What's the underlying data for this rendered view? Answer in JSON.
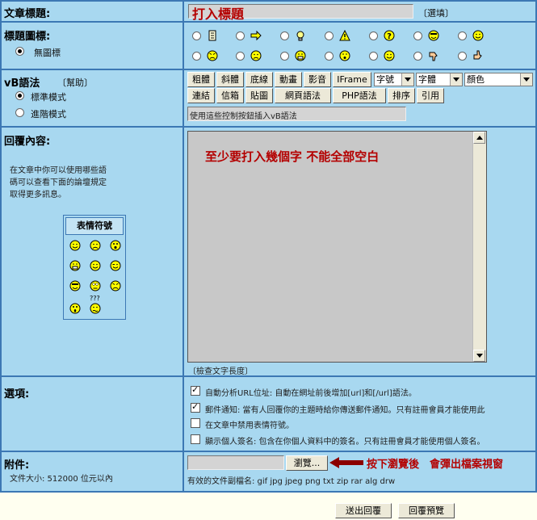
{
  "subject": {
    "label": "文章標題:",
    "value": "打入標題",
    "optional": "〔選填〕"
  },
  "title_icon": {
    "label": "標題圖標:",
    "no_icon_label": "無圖標"
  },
  "vbcode": {
    "label": "vB語法",
    "help": "〔幫助〕",
    "mode_standard": "標準模式",
    "mode_advanced": "進階模式",
    "buttons_row1": [
      "粗體",
      "斜體",
      "底線",
      "動畫",
      "影音",
      "IFrame"
    ],
    "buttons_row2": [
      "連結",
      "信箱",
      "貼圖",
      "網頁語法",
      "PHP語法",
      "排序",
      "引用"
    ],
    "size_select": "字號",
    "font_select": "字體",
    "color_select": "顏色",
    "status_text": "使用這些控制按鈕插入vB語法"
  },
  "reply": {
    "label": "回覆內容:",
    "help_text": [
      "在文章中你可以使用哪些語",
      "碼可以查看下面的論壇規定",
      "取得更多訊息。"
    ],
    "smilies_title": "表情符號",
    "smilies_extra": "???",
    "message_text": "至少要打入幾個字 不能全部空白",
    "check_length": "〔檢查文字長度〕"
  },
  "options": {
    "label": "選項:",
    "items": [
      {
        "text": "自動分析URL位址: 自動在網址前後增加[url]和[/url]語法。",
        "checked": true
      },
      {
        "text": "郵件通知: 當有人回覆你的主題時給你傳送郵件通知。只有註冊會員才能使用此",
        "checked": true
      },
      {
        "text": "在文章中禁用表情符號。",
        "checked": false
      },
      {
        "text": "顯示個人簽名: 包含在你個人資料中的簽名。只有註冊會員才能使用個人簽名。",
        "checked": false
      }
    ]
  },
  "attachment": {
    "label": "附件:",
    "size_limit": "文件大小: 512000 位元以內",
    "browse_button": "瀏覽...",
    "annotation": "按下瀏覽後　會彈出檔案視窗",
    "allowed_ext": "有效的文件副檔名: gif jpg jpeg png txt zip rar alg drw"
  },
  "actions": {
    "submit": "送出回覆",
    "preview": "回覆預覽"
  },
  "colors": {
    "frame": "#3c78b4",
    "cell": "#a8d8f0",
    "annotation_red": "#b40000",
    "arrow": "#8b0000"
  }
}
